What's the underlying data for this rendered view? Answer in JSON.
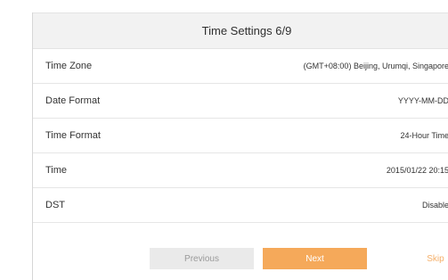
{
  "wizard": {
    "title": "Time Settings 6/9",
    "rows": [
      {
        "label": "Time Zone",
        "value": "(GMT+08:00) Beijing, Urumqi, Singapore"
      },
      {
        "label": "Date Format",
        "value": "YYYY-MM-DD"
      },
      {
        "label": "Time Format",
        "value": "24-Hour Time"
      },
      {
        "label": "Time",
        "value": "2015/01/22  20:15"
      },
      {
        "label": "DST",
        "value": "Disable"
      }
    ],
    "buttons": {
      "previous": "Previous",
      "next": "Next",
      "skip": "Skip"
    }
  },
  "colors": {
    "accent": "#f5a95a",
    "header_bg": "#f2f2f2",
    "disabled_button_bg": "#eaeaea"
  }
}
